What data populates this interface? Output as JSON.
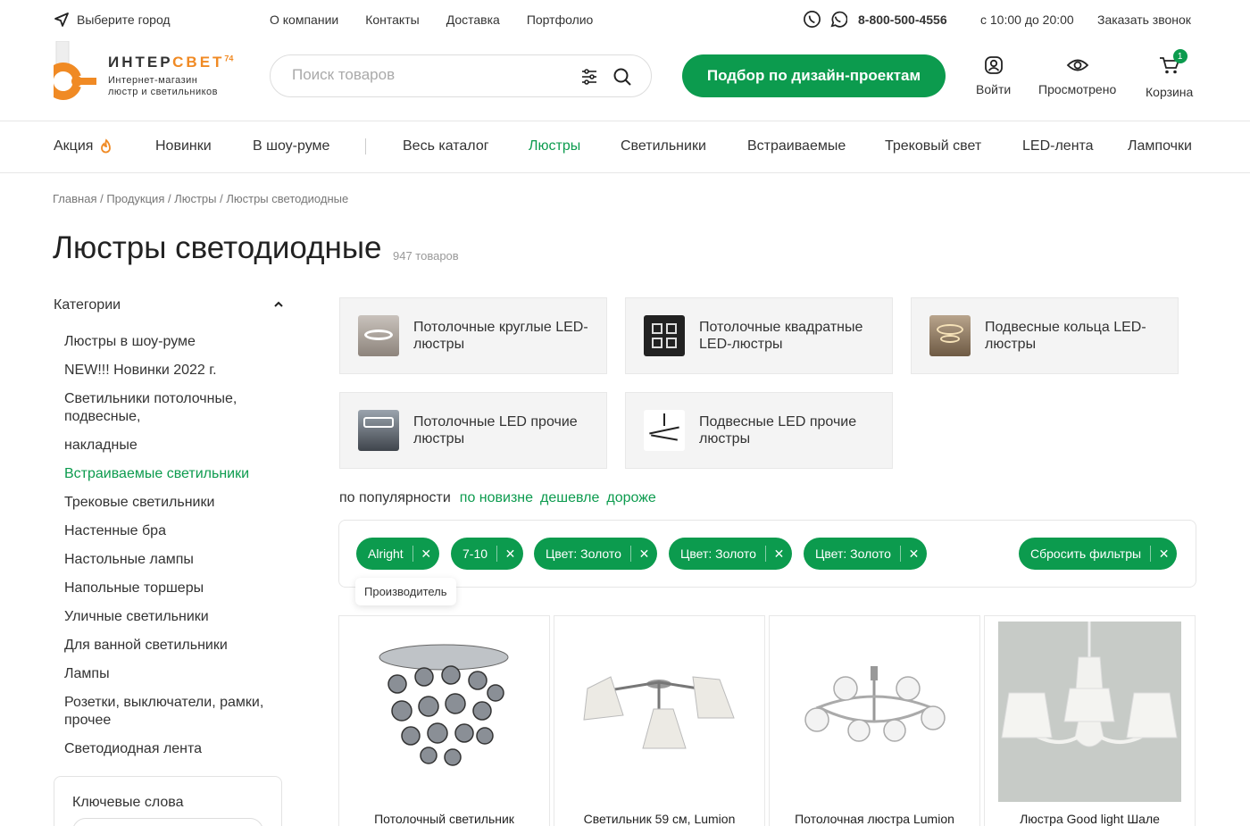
{
  "topbar": {
    "city_label": "Выберите город",
    "links": [
      "О компании",
      "Контакты",
      "Доставка",
      "Портфолио"
    ],
    "phone": "8-800-500-4556",
    "hours": "с 10:00 до 20:00",
    "callback": "Заказать звонок"
  },
  "logo": {
    "brand_part1": "ИНТЕР",
    "brand_part2": "СВЕТ",
    "brand_suffix": "74",
    "tagline_line1": "Интернет-магазин",
    "tagline_line2": "люстр и светильников"
  },
  "search": {
    "placeholder": "Поиск товаров"
  },
  "design_button": "Подбор по дизайн-проектам",
  "header_actions": {
    "login": "Войти",
    "viewed": "Просмотрено",
    "cart": "Корзина",
    "cart_count": "1"
  },
  "nav": {
    "items": [
      "Акция",
      "Новинки",
      "В шоу-руме",
      "Весь каталог",
      "Люстры",
      "Светильники",
      "Встраиваемые",
      "Трековый свет",
      "LED-лента",
      "Лампочки"
    ],
    "active_index": 4
  },
  "breadcrumb": "Главная / Продукция / Люстры / Люстры светодиодные",
  "page": {
    "title": "Люстры светодиодные",
    "count": "947 товаров"
  },
  "sidebar": {
    "categories_title": "Категории",
    "items": [
      "Люстры в шоу-руме",
      "NEW!!! Новинки 2022 г.",
      "Светильники потолочные, подвесные,",
      "накладные",
      "Встраиваемые светильники",
      "Трековые светильники",
      "Настенные бра",
      "Настольные лампы",
      "Напольные торшеры",
      "Уличные светильники",
      "Для ванной светильники",
      "Лампы",
      "Розетки, выключатели, рамки, прочее",
      "Светодиодная лента"
    ],
    "active_index": 4,
    "keywords_title": "Ключевые слова"
  },
  "subcategories": [
    "Потолочные круглые LED-люстры",
    "Потолочные квадратные LED-люстры",
    "Подвесные кольца LED-люстры",
    "Потолочные LED прочие люстры",
    "Подвесные LED прочие люстры"
  ],
  "sort": {
    "label": "по популярности",
    "links": [
      "по новизне",
      "дешевле",
      "дороже"
    ]
  },
  "filters": {
    "chips": [
      "Alright",
      "7-10",
      "Цвет: Золото",
      "Цвет: Золото",
      "Цвет: Золото"
    ],
    "reset": "Сбросить фильтры",
    "tooltip": "Производитель"
  },
  "products": [
    "Потолочный светильник",
    "Светильник 59 см, Lumion",
    "Потолочная люстра Lumion",
    "Люстра Good light Шале"
  ],
  "colors": {
    "accent": "#0c9b4e",
    "brand_orange": "#f08a24"
  }
}
